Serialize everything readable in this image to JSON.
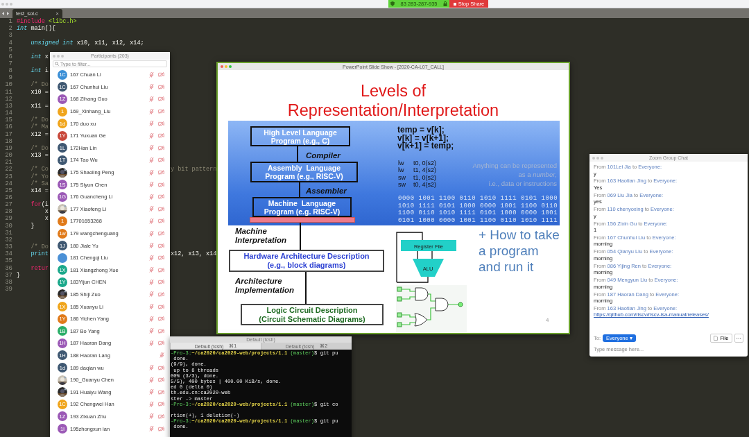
{
  "meeting_bar": {
    "meeting_id": "83 283-287-935",
    "stop_share": "Stop Share"
  },
  "editor": {
    "tab": {
      "label": "test_sol.c",
      "close": "×"
    },
    "lines": [
      {
        "num": "1",
        "parts": [
          {
            "t": "#include",
            "kind": "keyword"
          },
          {
            "t": " <libc.h>",
            "kind": "string"
          }
        ]
      },
      {
        "num": "2",
        "parts": [
          {
            "t": "int",
            "kind": "type"
          },
          {
            "t": " main(){",
            "kind": "plain"
          }
        ]
      },
      {
        "num": "3"
      },
      {
        "num": "4",
        "parts": [
          {
            "t": "    unsigned int",
            "kind": "type"
          },
          {
            "t": " x10, x11, x12, x14;",
            "kind": "plain"
          }
        ]
      },
      {
        "num": "5"
      },
      {
        "num": "6",
        "parts": [
          {
            "t": "    int",
            "kind": "type"
          },
          {
            "t": " x",
            "kind": "plain"
          }
        ]
      },
      {
        "num": "7"
      },
      {
        "num": "8",
        "parts": [
          {
            "t": "    int",
            "kind": "type"
          },
          {
            "t": " i",
            "kind": "plain"
          }
        ]
      },
      {
        "num": "9"
      },
      {
        "num": "10",
        "parts": [
          {
            "t": "    /* Do",
            "kind": "comment"
          }
        ]
      },
      {
        "num": "11",
        "parts": [
          {
            "t": "    x10 =",
            "kind": "plain"
          }
        ]
      },
      {
        "num": "12"
      },
      {
        "num": "13",
        "parts": [
          {
            "t": "    x11 =",
            "kind": "plain"
          }
        ]
      },
      {
        "num": "14"
      },
      {
        "num": "15",
        "parts": [
          {
            "t": "    /* Do",
            "kind": "comment"
          }
        ]
      },
      {
        "num": "16",
        "parts": [
          {
            "t": "    /* Ma",
            "kind": "comment"
          }
        ]
      },
      {
        "num": "17",
        "parts": [
          {
            "t": "    x12 =",
            "kind": "plain"
          }
        ]
      },
      {
        "num": "18"
      },
      {
        "num": "19",
        "parts": [
          {
            "t": "    /* Do",
            "kind": "comment"
          }
        ]
      },
      {
        "num": "20",
        "parts": [
          {
            "t": "    x13 =",
            "kind": "plain"
          }
        ]
      },
      {
        "num": "21"
      },
      {
        "num": "22",
        "parts": [
          {
            "t": "    /* Co",
            "kind": "comment"
          }
        ],
        "right": {
          "t": "y bit pattern",
          "kind": "comment"
        }
      },
      {
        "num": "23",
        "parts": [
          {
            "t": "    /* Yo",
            "kind": "comment"
          }
        ]
      },
      {
        "num": "24",
        "parts": [
          {
            "t": "    /* Sa",
            "kind": "comment"
          }
        ]
      },
      {
        "num": "25",
        "parts": [
          {
            "t": "    x14 =",
            "kind": "plain"
          }
        ]
      },
      {
        "num": "26"
      },
      {
        "num": "27",
        "parts": [
          {
            "t": "    for",
            "kind": "keyword"
          },
          {
            "t": "(i",
            "kind": "plain"
          }
        ]
      },
      {
        "num": "28",
        "parts": [
          {
            "t": "        x",
            "kind": "plain"
          }
        ]
      },
      {
        "num": "29",
        "parts": [
          {
            "t": "        x",
            "kind": "plain"
          }
        ]
      },
      {
        "num": "30",
        "parts": [
          {
            "t": "    }",
            "kind": "plain"
          }
        ]
      },
      {
        "num": "31"
      },
      {
        "num": "32"
      },
      {
        "num": "33",
        "parts": [
          {
            "t": "    /* Do",
            "kind": "comment"
          }
        ]
      },
      {
        "num": "34",
        "parts": [
          {
            "t": "    print",
            "kind": "function"
          }
        ],
        "right": {
          "t": "x12, x13, x14",
          "kind": "plain"
        }
      },
      {
        "num": "35"
      },
      {
        "num": "36",
        "parts": [
          {
            "t": "    retur",
            "kind": "keyword"
          }
        ]
      },
      {
        "num": "37",
        "parts": [
          {
            "t": "}",
            "kind": "plain"
          }
        ]
      },
      {
        "num": "38"
      },
      {
        "num": "39"
      }
    ]
  },
  "participants": {
    "title": "Participants (203)",
    "search": {
      "placeholder": "Type to filter..."
    },
    "rows": [
      {
        "name": "167 Chuan Li",
        "initials": "1C",
        "color": "#3b8fd6",
        "video_off": true
      },
      {
        "name": "167 Chunhui Liu",
        "initials": "1C",
        "color": "#3f5872",
        "video_off": true
      },
      {
        "name": "168 Zihang Guo",
        "initials": "1Z",
        "color": "#9b59b6",
        "video_off": true
      },
      {
        "name": "169_Xinhang_Liu",
        "initials": "1",
        "color": "#f0a51c",
        "video_off": true
      },
      {
        "name": "170 duo xu",
        "initials": "1d",
        "color": "#f0a51c",
        "video_off": true
      },
      {
        "name": "171 Yuxuan Ge",
        "initials": "1Y",
        "color": "#c8473a",
        "video_off": true
      },
      {
        "name": "172Han Lin",
        "initials": "1L",
        "color": "#3f5872",
        "video_off": true
      },
      {
        "name": "174 Tao Wu",
        "initials": "1T",
        "color": "#3f5872",
        "video_off": true
      },
      {
        "name": "175 Shaoling Peng",
        "kind": "picture",
        "video_off": true
      },
      {
        "name": "175 Siyun Chen",
        "initials": "1S",
        "color": "#9b59b6",
        "video_off": true
      },
      {
        "name": "176 Guancheng Li",
        "initials": "1G",
        "color": "#9b59b6",
        "video_off": true
      },
      {
        "name": "177 Xiaofeng Li",
        "kind": "picture",
        "video_off": true
      },
      {
        "name": "17701653268",
        "initials": "1",
        "color": "#e07a1a",
        "video_off": true
      },
      {
        "name": "179 wangchenguang",
        "initials": "1w",
        "color": "#e07a1a",
        "video_off": true
      },
      {
        "name": "180 Jiale Yu",
        "initials": "1J",
        "color": "#3f5872",
        "video_off": true
      },
      {
        "name": "181 Chengqi Liu",
        "color": "#4a90d6",
        "video_off": true
      },
      {
        "name": "181 Xiangzhong Xue",
        "initials": "1X",
        "color": "#1aa88a",
        "video_off": true
      },
      {
        "name": "183Yijun CHEN",
        "initials": "1Y",
        "color": "#1aa88a",
        "video_off": true
      },
      {
        "name": "185 Shiji Zuo",
        "kind": "picture",
        "video_off": true
      },
      {
        "name": "185 Xuanyu Li",
        "initials": "1X",
        "color": "#f0a51c",
        "video_off": true
      },
      {
        "name": "186 Yichen Yang",
        "initials": "1Y",
        "color": "#e07a1a",
        "video_off": true
      },
      {
        "name": "187 Bo Yang",
        "initials": "1B",
        "color": "#2aae68",
        "video_off": true
      },
      {
        "name": "187 Haoran Dang",
        "initials": "1H",
        "color": "#9b59b6",
        "video_off": true
      },
      {
        "name": "188 Haoran Lang",
        "initials": "1H",
        "color": "#3f5872",
        "video_off": false
      },
      {
        "name": "189 daqian wu",
        "initials": "1d",
        "color": "#3f5872",
        "video_off": true
      },
      {
        "name": "190_Guanyu Chen",
        "kind": "picture",
        "video_off": true
      },
      {
        "name": "191 Huaiyu Wang",
        "kind": "picture",
        "video_off": true
      },
      {
        "name": "192 Chengwei Han",
        "initials": "1C",
        "color": "#f0a51c",
        "video_off": true
      },
      {
        "name": "193 Zixuan Zhu",
        "initials": "1Z",
        "color": "#9b59b6",
        "video_off": true
      },
      {
        "name": "195zhongxun ian",
        "initials": "1l",
        "color": "#9b59b6",
        "video_off": true
      }
    ]
  },
  "slide_window": {
    "title": "PowerPoint Slide Show - [2020-CA-L07_CALL]",
    "slide": {
      "title_lines": [
        "Levels of",
        "Representation/Interpretation"
      ],
      "levels": [
        [
          "High Level Language",
          "Program (e.g., C)"
        ],
        [
          "Assembly  Language",
          "Program (e.g., RISC-V)"
        ],
        [
          "Machine  Language",
          "Program (e.g. RISC-V)"
        ]
      ],
      "transitions": [
        "Compiler",
        "Assembler"
      ],
      "code": [
        "temp = v[k];",
        "v[k] = v[k+1];",
        "v[k+1] = temp;"
      ],
      "assembly": [
        {
          "op": "lw",
          "args": "t0, 0(s2)"
        },
        {
          "op": "lw",
          "args": "t1, 4(s2)"
        },
        {
          "op": "sw",
          "args": "t1, 0(s2)"
        },
        {
          "op": "sw",
          "args": "t0, 4(s2)"
        }
      ],
      "caption": [
        "Anything can be represented",
        "as a *number*,",
        "i.e., data or instructions"
      ],
      "binary": [
        "0000 1001 1100 0110 1010 1111 0101 1000",
        "1010 1111 0101 1000 0000 1001 1100 0110",
        "1100 0110 1010 1111 0101 1000 0000 1001",
        "0101 1000 0000 1001 1100 0110 1010 1111"
      ],
      "machine_interpretation": [
        "Machine",
        "Interpretation"
      ],
      "hardware_box": [
        "Hardware Architecture Description",
        "(e.g., block diagrams)"
      ],
      "architecture_implementation": [
        "Architecture",
        "Implementation"
      ],
      "logic_box": [
        "Logic Circuit Description",
        "(Circuit Schematic Diagrams)"
      ],
      "register_file": "Register File",
      "alu": "ALU",
      "how_to": [
        "+ How to take",
        "a program",
        "and run it"
      ],
      "page_number": "4"
    }
  },
  "terminal": {
    "title": "Default (tcsh)",
    "tabs": [
      {
        "label": "Default (tcsh)",
        "shortcut": "⌘1",
        "selected": true
      },
      {
        "label": "Default (tcsh)",
        "shortcut": "⌘2",
        "selected": false
      }
    ],
    "lines": [
      {
        "kind": "prompt",
        "host": "-Pro-3:",
        "path": "~/ca2020/ca2020-web/projects/1.1",
        "branch": " (master)",
        "cmd": "$ git pu"
      },
      {
        "kind": "out",
        "text": " done."
      },
      {
        "kind": "out",
        "text": "(9/9), done."
      },
      {
        "kind": "out",
        "text": " up to 8 threads"
      },
      {
        "kind": "out",
        "text": "00% (3/3), done."
      },
      {
        "kind": "out",
        "text": "5/5), 400 bytes | 400.00 KiB/s, done."
      },
      {
        "kind": "out",
        "text": "ed 0 (delta 0)"
      },
      {
        "kind": "out",
        "text": "th.edu.cn:ca2020-web"
      },
      {
        "kind": "out",
        "text": "ster -> master"
      },
      {
        "kind": "prompt",
        "host": "-Pro-3:",
        "path": "~/ca2020/ca2020-web/projects/1.1",
        "branch": " (master)",
        "cmd": "$ git co"
      },
      {
        "kind": "blank"
      },
      {
        "kind": "out",
        "text": "rtion(+), 1 deletion(-)"
      },
      {
        "kind": "prompt",
        "host": "-Pro-3:",
        "path": "~/ca2020/ca2020-web/projects/1.1",
        "branch": " (master)",
        "cmd": "$ git pu"
      },
      {
        "kind": "out",
        "text": " done."
      }
    ]
  },
  "chat": {
    "title": "Zoom Group Chat",
    "messages": [
      {
        "from": "From",
        "sender": "101Lei Jia",
        "to": "to",
        "recipient": "Everyone:",
        "body": "y",
        "kind": "text"
      },
      {
        "from": "From",
        "sender": "163 Haotian Jing",
        "to": "to",
        "recipient": "Everyone:",
        "body": "Yes",
        "kind": "text"
      },
      {
        "from": "From",
        "sender": "069 Liu Jia",
        "to": "to",
        "recipient": "Everyone:",
        "body": "yes",
        "kind": "text"
      },
      {
        "from": "From",
        "sender": "110 chenyoxing",
        "to": "to",
        "recipient": "Everyone:",
        "body": "y",
        "kind": "text"
      },
      {
        "from": "From",
        "sender": "156 Zixin Gu",
        "to": "to",
        "recipient": "Everyone:",
        "body": "1",
        "kind": "text"
      },
      {
        "from": "From",
        "sender": "167 Chunhui Liu",
        "to": "to",
        "recipient": "Everyone:",
        "body": "morning",
        "kind": "text"
      },
      {
        "from": "From",
        "sender": "054 Qianyu Liu",
        "to": "to",
        "recipient": "Everyone:",
        "body": "morning",
        "kind": "text"
      },
      {
        "from": "From",
        "sender": "086 Yijing Ren",
        "to": "to",
        "recipient": "Everyone:",
        "body": "morning",
        "kind": "text"
      },
      {
        "from": "From",
        "sender": "049 Mengyun Liu",
        "to": "to",
        "recipient": "Everyone:",
        "body": "morning",
        "kind": "text"
      },
      {
        "from": "From",
        "sender": "187 Haoran Dang",
        "to": "to",
        "recipient": "Everyone:",
        "body": "morning",
        "kind": "text"
      },
      {
        "from": "From",
        "sender": "163 Haotian Jing",
        "to": "to",
        "recipient": "Everyone:",
        "body": "https://github.com/riscv/riscv-isa-manual/releases/",
        "kind": "link"
      }
    ],
    "to_label": "To:",
    "recipient_button": "Everyone ▾",
    "file_button": "File",
    "more_button": "···",
    "input": {
      "placeholder": "Type message here..."
    }
  }
}
